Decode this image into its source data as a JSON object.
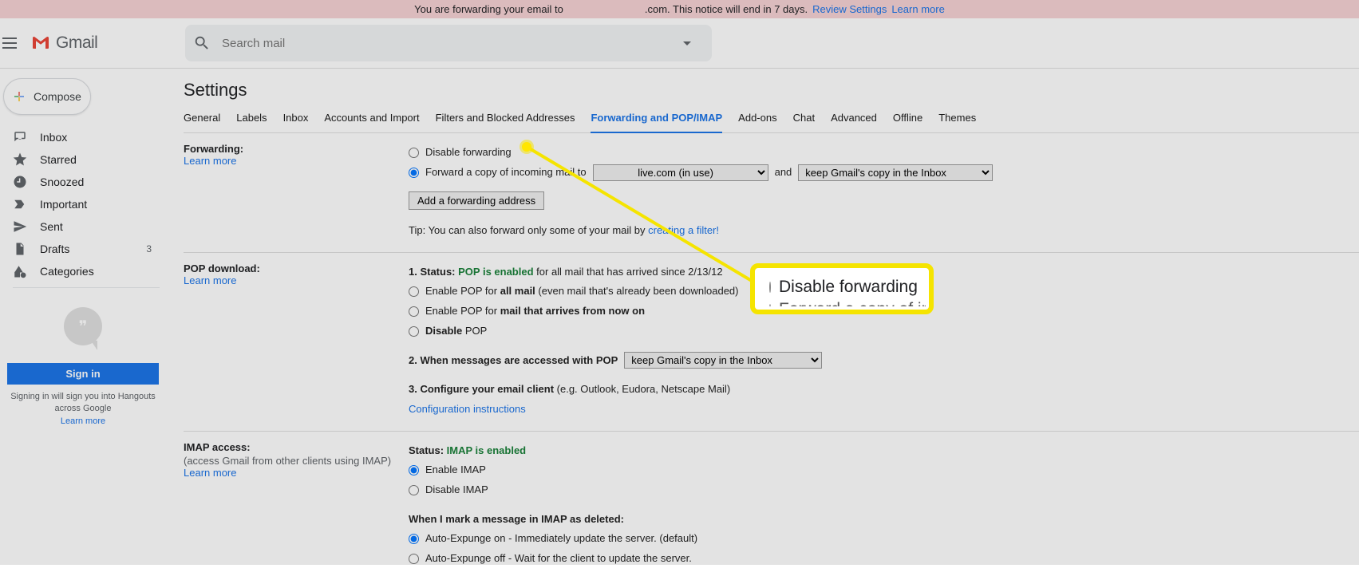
{
  "banner": {
    "text_a": "You are forwarding your email to",
    "text_b": ".com. This notice will end in 7 days.",
    "review": "Review Settings",
    "learn": "Learn more"
  },
  "brand": {
    "name": "Gmail"
  },
  "search": {
    "placeholder": "Search mail"
  },
  "compose": {
    "label": "Compose"
  },
  "nav": {
    "inbox": "Inbox",
    "starred": "Starred",
    "snoozed": "Snoozed",
    "important": "Important",
    "sent": "Sent",
    "drafts": "Drafts",
    "drafts_count": "3",
    "categories": "Categories"
  },
  "hangouts": {
    "signin": "Sign in",
    "note": "Signing in will sign you into Hangouts across Google",
    "learn": "Learn more"
  },
  "page": {
    "title": "Settings"
  },
  "tabs": {
    "general": "General",
    "labels": "Labels",
    "inbox": "Inbox",
    "accounts": "Accounts and Import",
    "filters": "Filters and Blocked Addresses",
    "forwarding": "Forwarding and POP/IMAP",
    "addons": "Add-ons",
    "chat": "Chat",
    "advanced": "Advanced",
    "offline": "Offline",
    "themes": "Themes"
  },
  "forwarding": {
    "heading": "Forwarding:",
    "learn": "Learn more",
    "disable": "Disable forwarding",
    "forward_copy": "Forward a copy of incoming mail to",
    "addr_sel": "live.com (in use)",
    "and": "and",
    "action_sel": "keep Gmail's copy in the Inbox",
    "add_btn": "Add a forwarding address",
    "tip_a": "Tip: You can also forward only some of your mail by ",
    "tip_link": "creating a filter!"
  },
  "pop": {
    "heading": "POP download:",
    "learn": "Learn more",
    "status_lead": "1. Status: ",
    "status_green": "POP is enabled",
    "status_tail": " for all mail that has arrived since 2/13/12",
    "enable_all_a": "Enable POP for ",
    "enable_all_b": "all mail",
    "enable_all_c": " (even mail that's already been downloaded)",
    "enable_now_a": "Enable POP for ",
    "enable_now_b": "mail that arrives from now on",
    "disable_a": "Disable ",
    "disable_b": "POP",
    "step2_a": "2. When messages are accessed with POP",
    "step2_sel": "keep Gmail's copy in the Inbox",
    "step3_a": "3. Configure your email client",
    "step3_b": " (e.g. Outlook, Eudora, Netscape Mail)",
    "conf_link": "Configuration instructions"
  },
  "imap": {
    "heading": "IMAP access:",
    "sub": "(access Gmail from other clients using IMAP)",
    "learn": "Learn more",
    "status_a": "Status: ",
    "status_green": "IMAP is enabled",
    "enable": "Enable IMAP",
    "disable": "Disable IMAP",
    "mark_a": "When I mark a message in IMAP as deleted:",
    "expunge_on": "Auto-Expunge on - Immediately update the server. (default)",
    "expunge_off": "Auto-Expunge off - Wait for the client to update the server."
  },
  "callout": {
    "row1": "Disable forwarding",
    "row2": "Forward a copy of in"
  }
}
